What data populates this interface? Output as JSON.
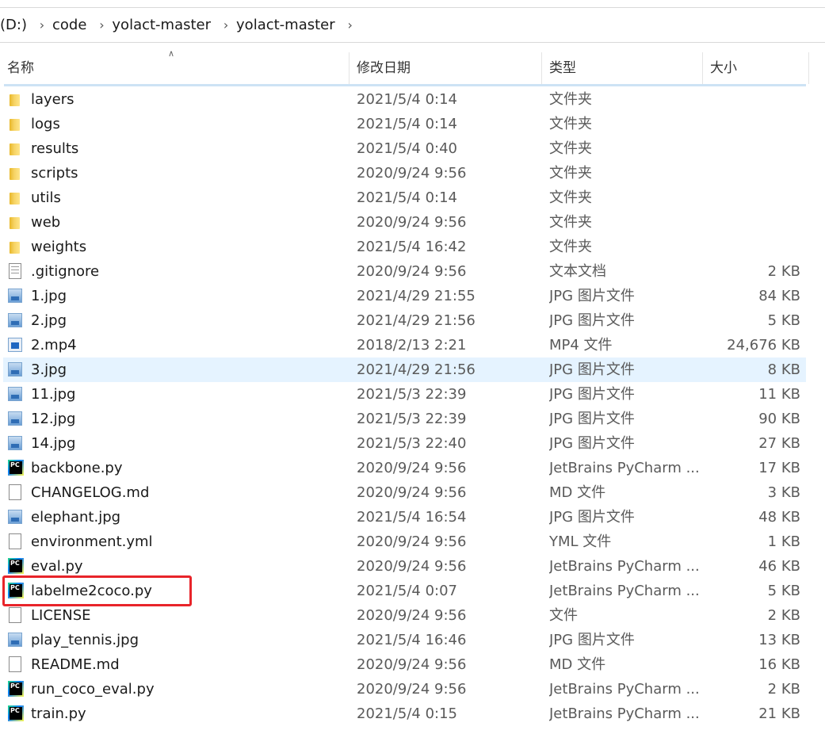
{
  "breadcrumb": {
    "drive": "(D:)",
    "items": [
      "code",
      "yolact-master",
      "yolact-master"
    ]
  },
  "columns": {
    "name": "名称",
    "date": "修改日期",
    "type": "类型",
    "size": "大小"
  },
  "colors": {
    "selected_row": "#e5f3ff",
    "highlight_box": "#e8242a",
    "header_line": "#cde3f5"
  },
  "files": [
    {
      "icon": "folder-icon",
      "name": "layers",
      "date": "2021/5/4 0:14",
      "type": "文件夹",
      "size": ""
    },
    {
      "icon": "folder-icon",
      "name": "logs",
      "date": "2021/5/4 0:14",
      "type": "文件夹",
      "size": ""
    },
    {
      "icon": "folder-icon",
      "name": "results",
      "date": "2021/5/4 0:40",
      "type": "文件夹",
      "size": ""
    },
    {
      "icon": "folder-icon",
      "name": "scripts",
      "date": "2020/9/24 9:56",
      "type": "文件夹",
      "size": ""
    },
    {
      "icon": "folder-icon",
      "name": "utils",
      "date": "2021/5/4 0:14",
      "type": "文件夹",
      "size": ""
    },
    {
      "icon": "folder-icon",
      "name": "web",
      "date": "2020/9/24 9:56",
      "type": "文件夹",
      "size": ""
    },
    {
      "icon": "folder-icon",
      "name": "weights",
      "date": "2021/5/4 16:42",
      "type": "文件夹",
      "size": ""
    },
    {
      "icon": "text-file-icon",
      "name": ".gitignore",
      "date": "2020/9/24 9:56",
      "type": "文本文档",
      "size": "2 KB"
    },
    {
      "icon": "image-file-icon",
      "name": "1.jpg",
      "date": "2021/4/29 21:55",
      "type": "JPG 图片文件",
      "size": "84 KB"
    },
    {
      "icon": "image-file-icon",
      "name": "2.jpg",
      "date": "2021/4/29 21:56",
      "type": "JPG 图片文件",
      "size": "5 KB"
    },
    {
      "icon": "video-file-icon",
      "name": "2.mp4",
      "date": "2018/2/13 2:21",
      "type": "MP4 文件",
      "size": "24,676 KB"
    },
    {
      "icon": "image-file-icon",
      "name": "3.jpg",
      "date": "2021/4/29 21:56",
      "type": "JPG 图片文件",
      "size": "8 KB",
      "selected": true
    },
    {
      "icon": "image-file-icon",
      "name": "11.jpg",
      "date": "2021/5/3 22:39",
      "type": "JPG 图片文件",
      "size": "11 KB"
    },
    {
      "icon": "image-file-icon",
      "name": "12.jpg",
      "date": "2021/5/3 22:39",
      "type": "JPG 图片文件",
      "size": "90 KB"
    },
    {
      "icon": "image-file-icon",
      "name": "14.jpg",
      "date": "2021/5/3 22:40",
      "type": "JPG 图片文件",
      "size": "27 KB"
    },
    {
      "icon": "pycharm-file-icon",
      "name": "backbone.py",
      "date": "2020/9/24 9:56",
      "type": "JetBrains PyCharm ...",
      "size": "17 KB"
    },
    {
      "icon": "blank-file-icon",
      "name": "CHANGELOG.md",
      "date": "2020/9/24 9:56",
      "type": "MD 文件",
      "size": "3 KB"
    },
    {
      "icon": "image-file-icon",
      "name": "elephant.jpg",
      "date": "2021/5/4 16:54",
      "type": "JPG 图片文件",
      "size": "48 KB"
    },
    {
      "icon": "blank-file-icon",
      "name": "environment.yml",
      "date": "2020/9/24 9:56",
      "type": "YML 文件",
      "size": "1 KB"
    },
    {
      "icon": "pycharm-file-icon",
      "name": "eval.py",
      "date": "2020/9/24 9:56",
      "type": "JetBrains PyCharm ...",
      "size": "46 KB"
    },
    {
      "icon": "pycharm-file-icon",
      "name": "labelme2coco.py",
      "date": "2021/5/4 0:07",
      "type": "JetBrains PyCharm ...",
      "size": "5 KB"
    },
    {
      "icon": "blank-file-icon",
      "name": "LICENSE",
      "date": "2020/9/24 9:56",
      "type": "文件",
      "size": "2 KB"
    },
    {
      "icon": "image-file-icon",
      "name": "play_tennis.jpg",
      "date": "2021/5/4 16:46",
      "type": "JPG 图片文件",
      "size": "13 KB"
    },
    {
      "icon": "blank-file-icon",
      "name": "README.md",
      "date": "2020/9/24 9:56",
      "type": "MD 文件",
      "size": "16 KB"
    },
    {
      "icon": "pycharm-file-icon",
      "name": "run_coco_eval.py",
      "date": "2020/9/24 9:56",
      "type": "JetBrains PyCharm ...",
      "size": "2 KB"
    },
    {
      "icon": "pycharm-file-icon",
      "name": "train.py",
      "date": "2021/5/4 0:15",
      "type": "JetBrains PyCharm ...",
      "size": "21 KB"
    }
  ]
}
